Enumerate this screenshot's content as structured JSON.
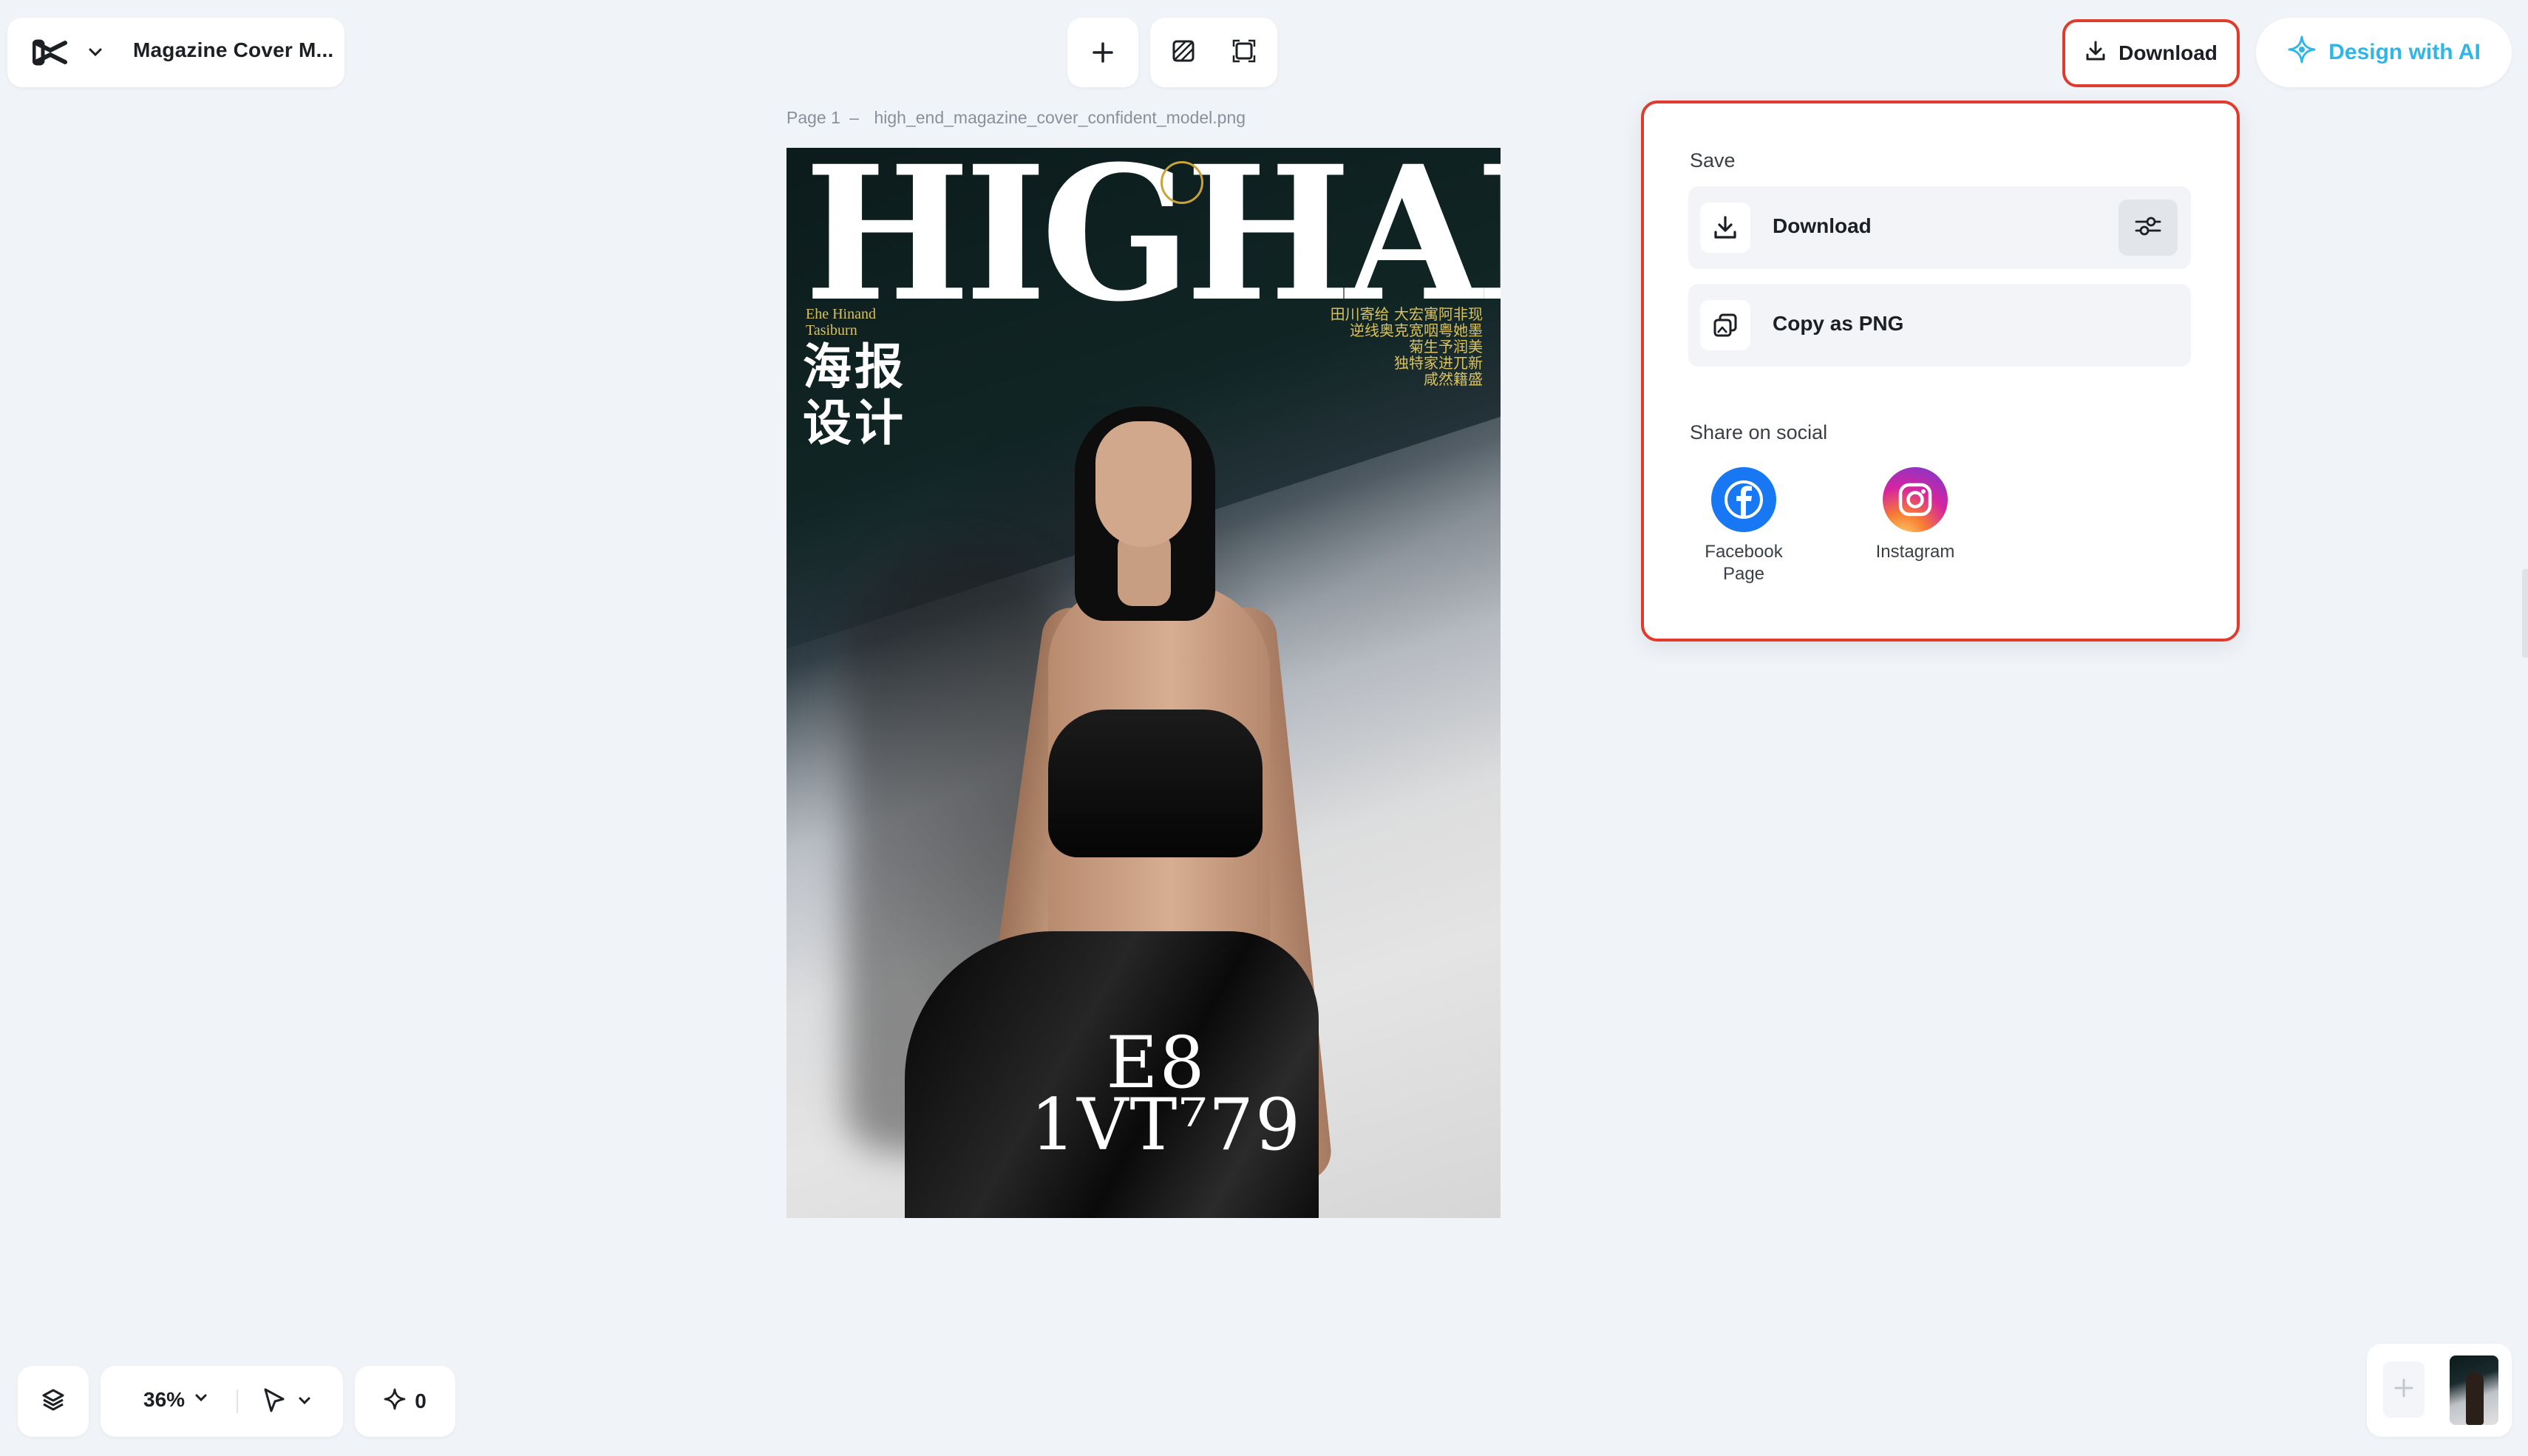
{
  "project": {
    "title": "Magazine Cover M..."
  },
  "header": {
    "download_label": "Download",
    "design_ai_label": "Design with AI"
  },
  "canvas": {
    "page_label": "Page 1",
    "separator": "–",
    "file_name": "high_end_magazine_cover_confident_model.png"
  },
  "cover": {
    "masthead": "HIGHANE",
    "small_en": "Ehe Hinand\nTasiburn",
    "cn_title": "海报\n设计",
    "cn_right": "田川寄给 大宏寓阿非现\n逆线奥克宽咽粤她墨\n菊生予润美\n独特家进兀新\n咸然籍盛",
    "issue_text": "E8\n1VT⁷79"
  },
  "download_menu": {
    "save_heading": "Save",
    "download_label": "Download",
    "copy_label": "Copy as PNG",
    "share_heading": "Share on social",
    "social": [
      {
        "name": "Facebook Page"
      },
      {
        "name": "Instagram"
      }
    ]
  },
  "bottom_bar": {
    "zoom": "36%",
    "credits": "0"
  },
  "colors": {
    "accent": "#e03b2d",
    "ai_blue": "#2fb6e6",
    "facebook": "#1877f2"
  }
}
